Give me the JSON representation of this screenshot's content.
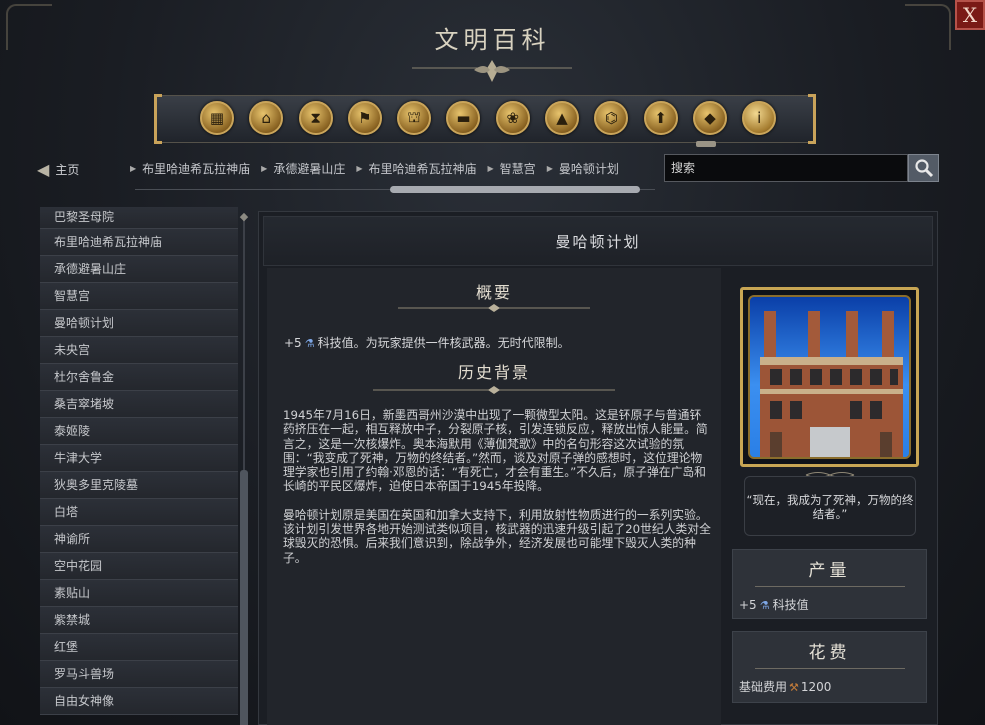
{
  "window": {
    "title": "文明百科",
    "close_label": "X"
  },
  "icon_bar": {
    "icons": [
      "wonders-icon",
      "buildings-icon",
      "hourglass-icon",
      "flag-icon",
      "government-icon",
      "terrain-icon",
      "resources-icon",
      "mountain-icon",
      "improvement-icon",
      "promotion-icon",
      "units-icon",
      "info-icon"
    ]
  },
  "nav": {
    "home_label": "主页",
    "breadcrumbs": [
      "布里哈迪希瓦拉神庙",
      "承德避暑山庄",
      "布里哈迪希瓦拉神庙",
      "智慧宫",
      "曼哈顿计划"
    ],
    "search_placeholder": "搜索"
  },
  "sidebar": {
    "items": [
      "巴黎圣母院",
      "布里哈迪希瓦拉神庙",
      "承德避暑山庄",
      "智慧宫",
      "曼哈顿计划",
      "未央宫",
      "杜尔舍鲁金",
      "桑吉窣堵坡",
      "泰姬陵",
      "牛津大学",
      "狄奥多里克陵墓",
      "白塔",
      "神谕所",
      "空中花园",
      "素贴山",
      "紫禁城",
      "红堡",
      "罗马斗兽场",
      "自由女神像"
    ]
  },
  "article": {
    "title": "曼哈顿计划",
    "summary_heading": "概要",
    "summary_prefix": "+5",
    "summary_text": "科技值。为玩家提供一件核武器。无时代限制。",
    "history_heading": "历史背景",
    "history_p1": "1945年7月16日，新墨西哥州沙漠中出现了一颗微型太阳。这是钚原子与普通钚药挤压在一起，相互释放中子，分裂原子核，引发连锁反应，释放出惊人能量。简言之，这是一次核爆炸。奥本海默用《薄伽梵歌》中的名句形容这次试验的氛围：“我变成了死神，万物的终结者。”然而，谈及对原子弹的感想时，这位理论物理学家也引用了约翰·邓恩的话：“有死亡，才会有重生。”不久后，原子弹在广岛和长崎的平民区爆炸，迫使日本帝国于1945年投降。",
    "history_p2": "曼哈顿计划原是美国在英国和加拿大支持下，利用放射性物质进行的一系列实验。该计划引发世界各地开始测试类似项目，核武器的迅速升级引起了20世纪人类对全球毁灭的恐惧。后来我们意识到，除战争外，经济发展也可能埋下毁灭人类的种子。",
    "quote": "“现在，我成为了死神，万物的终结者。”"
  },
  "stats": {
    "yield_heading": "产量",
    "yield_value": "+5",
    "yield_label": "科技值",
    "cost_heading": "花费",
    "cost_label": "基础费用",
    "cost_value": "1200"
  },
  "colors": {
    "accent_gold": "#c8a654",
    "close_red": "#7a1a16",
    "science_blue": "#7ea7e6"
  }
}
